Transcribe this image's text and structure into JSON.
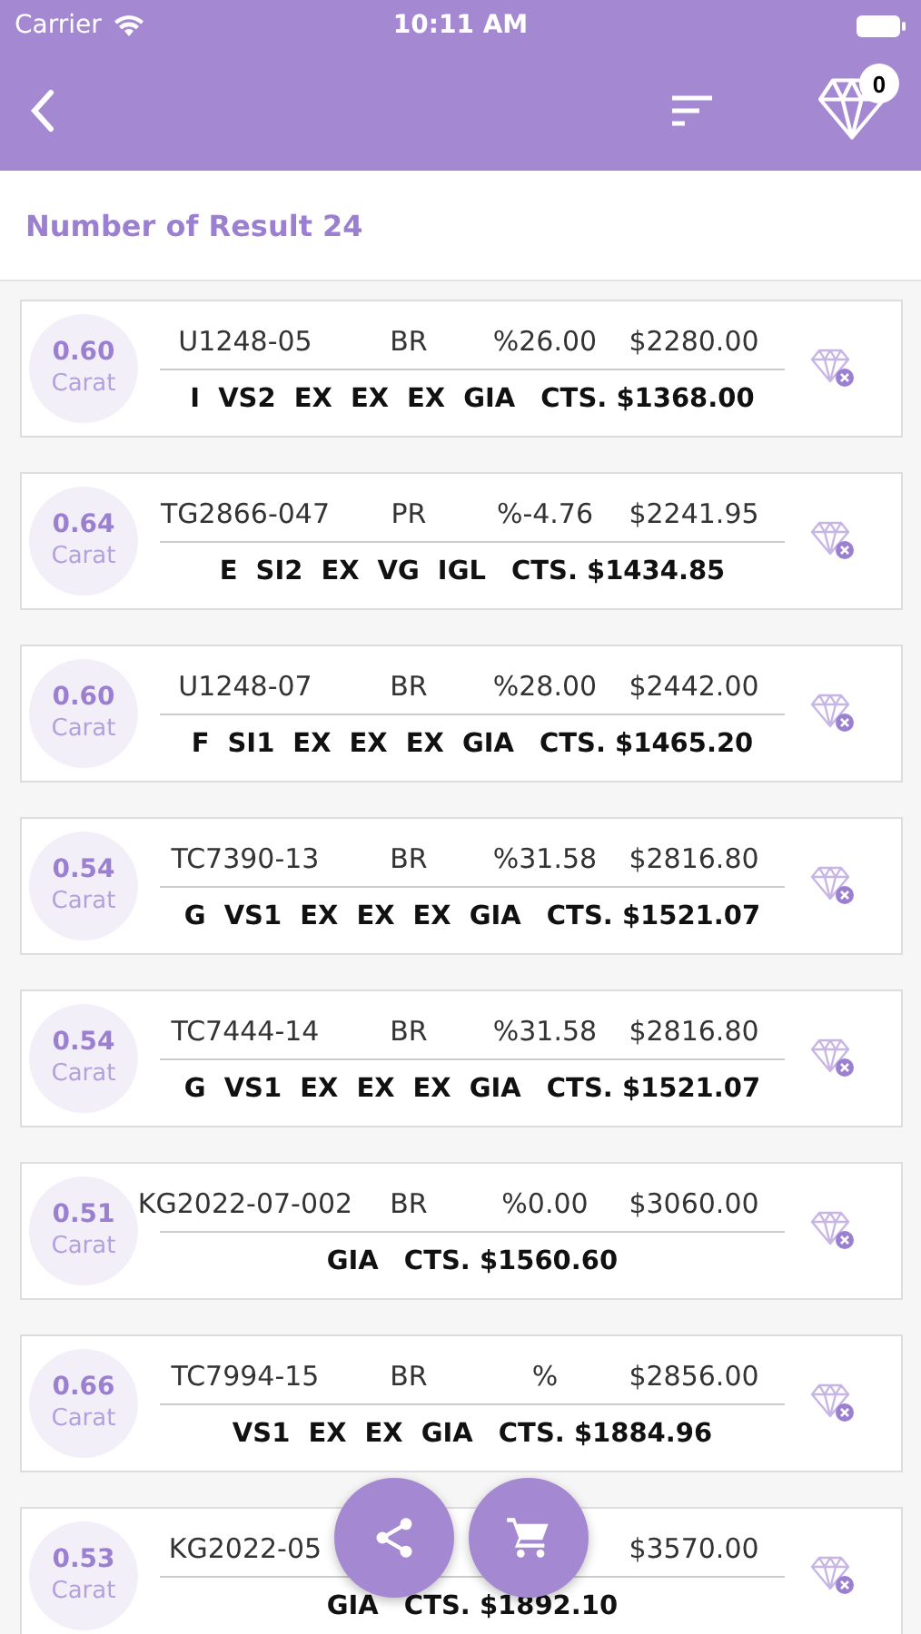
{
  "status_bar": {
    "carrier": "Carrier",
    "time": "10:11 AM"
  },
  "nav": {
    "cart_count": "0"
  },
  "result_label": "Number of Result 24",
  "items": [
    {
      "carat": "0.60",
      "unit": "Carat",
      "code": "U1248-05",
      "shape": "BR",
      "percent": "%26.00",
      "price": "$2280.00",
      "specs": [
        "I",
        "VS2",
        "EX",
        "EX",
        "EX",
        "GIA"
      ],
      "cts": "CTS. $1368.00"
    },
    {
      "carat": "0.64",
      "unit": "Carat",
      "code": "TG2866-047",
      "shape": "PR",
      "percent": "%-4.76",
      "price": "$2241.95",
      "specs": [
        "E",
        "SI2",
        "EX",
        "VG",
        "IGL"
      ],
      "cts": "CTS. $1434.85"
    },
    {
      "carat": "0.60",
      "unit": "Carat",
      "code": "U1248-07",
      "shape": "BR",
      "percent": "%28.00",
      "price": "$2442.00",
      "specs": [
        "F",
        "SI1",
        "EX",
        "EX",
        "EX",
        "GIA"
      ],
      "cts": "CTS. $1465.20"
    },
    {
      "carat": "0.54",
      "unit": "Carat",
      "code": "TC7390-13",
      "shape": "BR",
      "percent": "%31.58",
      "price": "$2816.80",
      "specs": [
        "G",
        "VS1",
        "EX",
        "EX",
        "EX",
        "GIA"
      ],
      "cts": "CTS. $1521.07"
    },
    {
      "carat": "0.54",
      "unit": "Carat",
      "code": "TC7444-14",
      "shape": "BR",
      "percent": "%31.58",
      "price": "$2816.80",
      "specs": [
        "G",
        "VS1",
        "EX",
        "EX",
        "EX",
        "GIA"
      ],
      "cts": "CTS. $1521.07"
    },
    {
      "carat": "0.51",
      "unit": "Carat",
      "code": "KG2022-07-002",
      "shape": "BR",
      "percent": "%0.00",
      "price": "$3060.00",
      "specs": [
        "GIA"
      ],
      "cts": "CTS. $1560.60"
    },
    {
      "carat": "0.66",
      "unit": "Carat",
      "code": "TC7994-15",
      "shape": "BR",
      "percent": "%",
      "price": "$2856.00",
      "specs": [
        "VS1",
        "EX",
        "EX",
        "GIA"
      ],
      "cts": "CTS. $1884.96"
    },
    {
      "carat": "0.53",
      "unit": "Carat",
      "code": "KG2022-05",
      "price": "$3570.00",
      "specs": [
        "GIA"
      ],
      "cts": "CTS. $1892.10"
    }
  ]
}
